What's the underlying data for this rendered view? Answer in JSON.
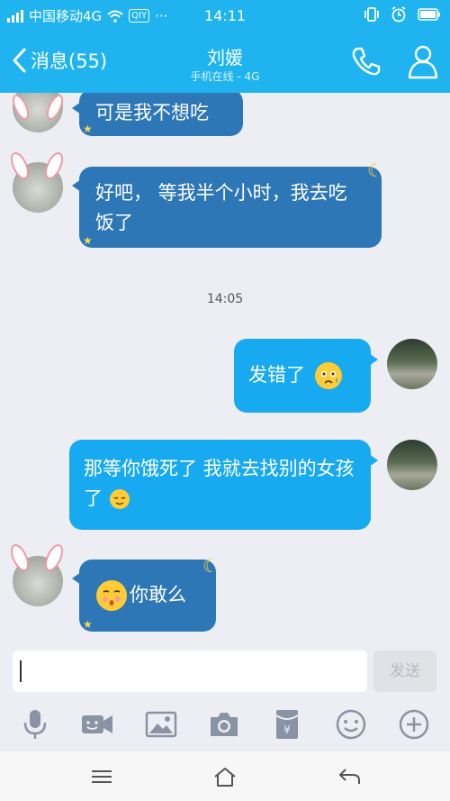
{
  "status_bar": {
    "carrier": "中国移动4G",
    "app_badge": "QIY",
    "more": "···",
    "time": "14:11",
    "icons": [
      "signal-icon",
      "wifi-icon",
      "vibrate-icon",
      "alarm-icon",
      "battery-icon"
    ]
  },
  "header": {
    "back_label": "消息(55)",
    "contact_name": "刘媛",
    "contact_status": "手机在线 - 4G",
    "icons": [
      "back-chevron-icon",
      "phone-icon",
      "profile-icon"
    ]
  },
  "messages": [
    {
      "side": "incoming",
      "text": "可是我不想吃"
    },
    {
      "side": "incoming",
      "text": "好吧， 等我半个小时，我去吃饭了"
    },
    {
      "side": "time",
      "text": "14:05"
    },
    {
      "side": "outgoing",
      "text": "发错了",
      "emoji": "tearful-face"
    },
    {
      "side": "outgoing",
      "text": "那等你饿死了 我就去找别的女孩了",
      "emoji": "relieved-face"
    },
    {
      "side": "incoming",
      "text": "你敢么",
      "emoji": "pouting-face"
    }
  ],
  "input": {
    "value": "",
    "placeholder": "",
    "send_label": "发送"
  },
  "toolbar": {
    "icons": [
      "microphone-icon",
      "video-icon",
      "image-icon",
      "camera-icon",
      "red-packet-icon",
      "emoji-icon",
      "plus-icon"
    ]
  },
  "nav": {
    "icons": [
      "menu-icon",
      "home-icon",
      "back-arrow-icon"
    ]
  },
  "colors": {
    "header": "#1fb4f0",
    "incoming_bubble": "#2d77b7",
    "outgoing_bubble": "#18aaf0",
    "background": "#eceef3"
  }
}
